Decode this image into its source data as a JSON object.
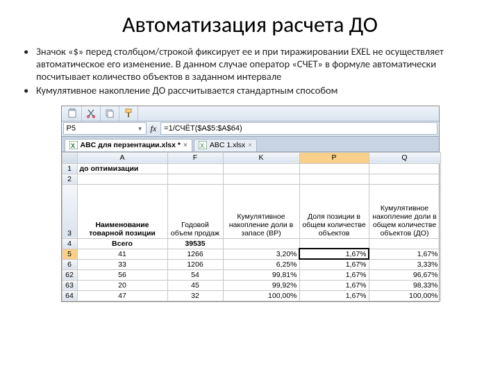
{
  "title": "Автоматизация расчета ДО",
  "bullets": [
    "Значок «$» перед столбцом/строкой фиксирует ее и при тиражировании EXEL не осуществляет автоматическое его изменение. В данном случае оператор «СЧЕТ» в формуле автоматически посчитывает количество объектов в заданном интервале",
    "Кумулятивное накопление ДО рассчитывается стандартным способом"
  ],
  "excel": {
    "namebox": "P5",
    "fx": "fx",
    "formula": "=1/СЧЁТ($A$5:$A$64)",
    "tabs": [
      {
        "label": "ABC для перзентации.xlsx *",
        "active": true
      },
      {
        "label": "ABC 1.xlsx",
        "active": false
      }
    ],
    "cols": {
      "corner": "",
      "A": "A",
      "F": "F",
      "K": "K",
      "P": "P",
      "Q": "Q"
    },
    "rows": [
      {
        "n": "1",
        "A": "до оптимизации",
        "F": "",
        "K": "",
        "P": "",
        "Q": ""
      },
      {
        "n": "2",
        "A": "",
        "F": "",
        "K": "",
        "P": "",
        "Q": ""
      },
      {
        "n": "3",
        "A": "Наименование товарной позиции",
        "F": "Годовой объем продаж",
        "K": "Кумулятивное накопление доли в запасе (ВР)",
        "P": "Доля позиции в общем количестве объектов",
        "Q": "Кумулятивное накопление доли в общем количестве объектов (ДО)"
      },
      {
        "n": "4",
        "A": "Всего",
        "F": "39535",
        "K": "",
        "P": "",
        "Q": ""
      },
      {
        "n": "5",
        "A": "41",
        "F": "1266",
        "K": "3,20%",
        "P": "1,67%",
        "Q": "1,67%"
      },
      {
        "n": "6",
        "A": "33",
        "F": "1206",
        "K": "6,25%",
        "P": "1,67%",
        "Q": "3,33%"
      },
      {
        "n": "62",
        "A": "56",
        "F": "54",
        "K": "99,81%",
        "P": "1,67%",
        "Q": "96,67%"
      },
      {
        "n": "63",
        "A": "20",
        "F": "45",
        "K": "99,92%",
        "P": "1,67%",
        "Q": "98,33%"
      },
      {
        "n": "64",
        "A": "47",
        "F": "32",
        "K": "100,00%",
        "P": "1,67%",
        "Q": "100,00%"
      }
    ]
  }
}
